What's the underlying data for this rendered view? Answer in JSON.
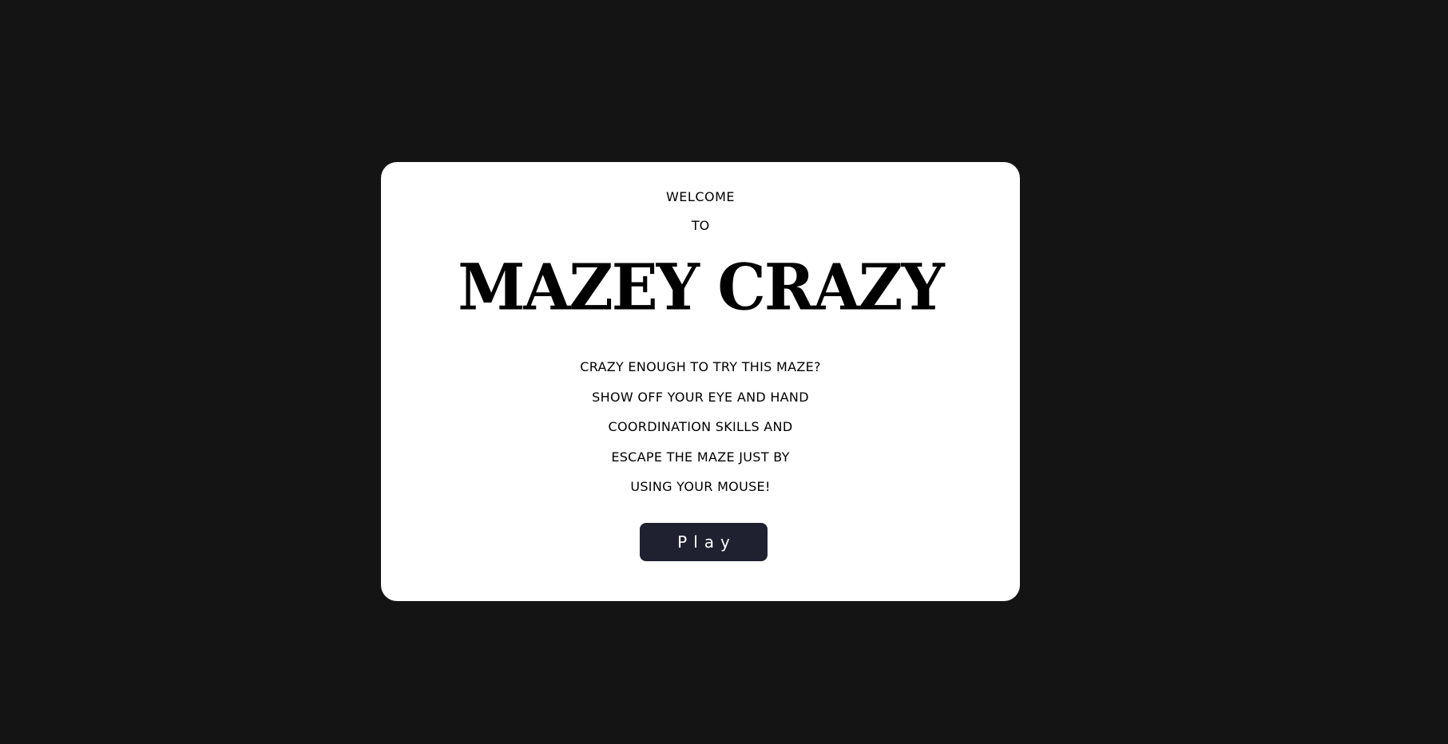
{
  "menu": {
    "welcome": "WELCOME",
    "to": "TO",
    "title": "MAZEY CRAZY",
    "description_lines": [
      "CRAZY ENOUGH TO TRY THIS MAZE?",
      "SHOW OFF YOUR EYE AND HAND",
      "COORDINATION SKILLS AND",
      "ESCAPE THE MAZE JUST BY",
      "USING YOUR MOUSE!"
    ],
    "play_label": "Play"
  },
  "colors": {
    "background": "#141414",
    "card": "#ffffff",
    "text": "#000000",
    "button": "#1f2130",
    "button_text": "#ffffff"
  }
}
